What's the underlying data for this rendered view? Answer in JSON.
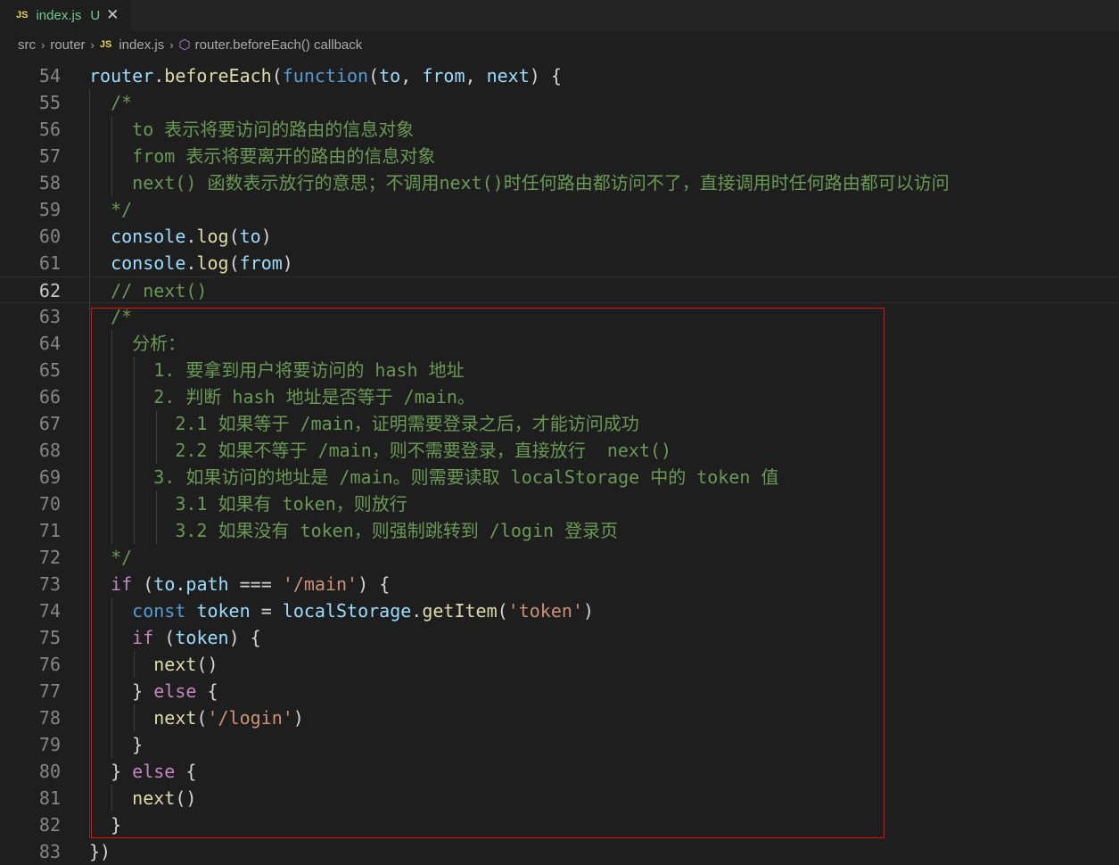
{
  "tab": {
    "badge": "JS",
    "name": "index.js",
    "status": "U",
    "close": "✕"
  },
  "breadcrumb": {
    "items": [
      "src",
      "router",
      "index.js",
      "router.beforeEach() callback"
    ],
    "separator": "›",
    "js_badge": "JS",
    "symbol_icon": "⬡"
  },
  "colors": {
    "background": "#1e1e1e",
    "highlight_box": "#e51400",
    "comment": "#6a9955",
    "function": "#dcdcaa",
    "variable": "#9cdcfe",
    "keyword": "#569cd6",
    "control": "#c586c0",
    "string": "#ce9178"
  },
  "editor": {
    "current_line": 62,
    "lines": [
      {
        "n": "54",
        "t": [
          [
            "router",
            "v"
          ],
          [
            ".",
            "p"
          ],
          [
            "beforeEach",
            "f"
          ],
          [
            "(",
            "p"
          ],
          [
            "function",
            "k"
          ],
          [
            "(",
            "p"
          ],
          [
            "to",
            "v"
          ],
          [
            ", ",
            "p"
          ],
          [
            "from",
            "v"
          ],
          [
            ", ",
            "p"
          ],
          [
            "next",
            "v"
          ],
          [
            ") {",
            "p"
          ]
        ]
      },
      {
        "n": "55",
        "t": [
          [
            "  /*",
            "c"
          ]
        ]
      },
      {
        "n": "56",
        "t": [
          [
            "    to 表示将要访问的路由的信息对象",
            "c"
          ]
        ]
      },
      {
        "n": "57",
        "t": [
          [
            "    from 表示将要离开的路由的信息对象",
            "c"
          ]
        ]
      },
      {
        "n": "58",
        "t": [
          [
            "    next() 函数表示放行的意思；不调用next()时任何路由都访问不了，直接调用时任何路由都可以访问",
            "c"
          ]
        ]
      },
      {
        "n": "59",
        "t": [
          [
            "  */",
            "c"
          ]
        ]
      },
      {
        "n": "60",
        "t": [
          [
            "  ",
            "p"
          ],
          [
            "console",
            "v"
          ],
          [
            ".",
            "p"
          ],
          [
            "log",
            "f"
          ],
          [
            "(",
            "p"
          ],
          [
            "to",
            "v"
          ],
          [
            ")",
            "p"
          ]
        ]
      },
      {
        "n": "61",
        "t": [
          [
            "  ",
            "p"
          ],
          [
            "console",
            "v"
          ],
          [
            ".",
            "p"
          ],
          [
            "log",
            "f"
          ],
          [
            "(",
            "p"
          ],
          [
            "from",
            "v"
          ],
          [
            ")",
            "p"
          ]
        ]
      },
      {
        "n": "62",
        "t": [
          [
            "  // next()",
            "c"
          ]
        ]
      },
      {
        "n": "63",
        "t": [
          [
            "  /*",
            "c"
          ]
        ]
      },
      {
        "n": "64",
        "t": [
          [
            "    分析：",
            "c"
          ]
        ]
      },
      {
        "n": "65",
        "t": [
          [
            "      1. 要拿到用户将要访问的 hash 地址",
            "c"
          ]
        ]
      },
      {
        "n": "66",
        "t": [
          [
            "      2. 判断 hash 地址是否等于 /main。",
            "c"
          ]
        ]
      },
      {
        "n": "67",
        "t": [
          [
            "        2.1 如果等于 /main，证明需要登录之后，才能访问成功",
            "c"
          ]
        ]
      },
      {
        "n": "68",
        "t": [
          [
            "        2.2 如果不等于 /main，则不需要登录，直接放行  next()",
            "c"
          ]
        ]
      },
      {
        "n": "69",
        "t": [
          [
            "      3. 如果访问的地址是 /main。则需要读取 localStorage 中的 token 值",
            "c"
          ]
        ]
      },
      {
        "n": "70",
        "t": [
          [
            "        3.1 如果有 token，则放行",
            "c"
          ]
        ]
      },
      {
        "n": "71",
        "t": [
          [
            "        3.2 如果没有 token，则强制跳转到 /login 登录页",
            "c"
          ]
        ]
      },
      {
        "n": "72",
        "t": [
          [
            "  */",
            "c"
          ]
        ]
      },
      {
        "n": "73",
        "t": [
          [
            "  ",
            "p"
          ],
          [
            "if",
            "r"
          ],
          [
            " (",
            "p"
          ],
          [
            "to",
            "v"
          ],
          [
            ".",
            "p"
          ],
          [
            "path",
            "v"
          ],
          [
            " === ",
            "p"
          ],
          [
            "'/main'",
            "s"
          ],
          [
            ") {",
            "p"
          ]
        ]
      },
      {
        "n": "74",
        "t": [
          [
            "    ",
            "p"
          ],
          [
            "const",
            "k"
          ],
          [
            " ",
            "p"
          ],
          [
            "token",
            "v"
          ],
          [
            " = ",
            "p"
          ],
          [
            "localStorage",
            "v"
          ],
          [
            ".",
            "p"
          ],
          [
            "getItem",
            "f"
          ],
          [
            "(",
            "p"
          ],
          [
            "'token'",
            "s"
          ],
          [
            ")",
            "p"
          ]
        ]
      },
      {
        "n": "75",
        "t": [
          [
            "    ",
            "p"
          ],
          [
            "if",
            "r"
          ],
          [
            " (",
            "p"
          ],
          [
            "token",
            "v"
          ],
          [
            ") {",
            "p"
          ]
        ]
      },
      {
        "n": "76",
        "t": [
          [
            "      ",
            "p"
          ],
          [
            "next",
            "f"
          ],
          [
            "()",
            "p"
          ]
        ]
      },
      {
        "n": "77",
        "t": [
          [
            "    } ",
            "p"
          ],
          [
            "else",
            "r"
          ],
          [
            " {",
            "p"
          ]
        ]
      },
      {
        "n": "78",
        "t": [
          [
            "      ",
            "p"
          ],
          [
            "next",
            "f"
          ],
          [
            "(",
            "p"
          ],
          [
            "'/login'",
            "s"
          ],
          [
            ")",
            "p"
          ]
        ]
      },
      {
        "n": "79",
        "t": [
          [
            "    }",
            "p"
          ]
        ]
      },
      {
        "n": "80",
        "t": [
          [
            "  } ",
            "p"
          ],
          [
            "else",
            "r"
          ],
          [
            " {",
            "p"
          ]
        ]
      },
      {
        "n": "81",
        "t": [
          [
            "    ",
            "p"
          ],
          [
            "next",
            "f"
          ],
          [
            "()",
            "p"
          ]
        ]
      },
      {
        "n": "82",
        "t": [
          [
            "  }",
            "p"
          ]
        ]
      },
      {
        "n": "83",
        "t": [
          [
            "})",
            "p"
          ]
        ]
      }
    ]
  }
}
